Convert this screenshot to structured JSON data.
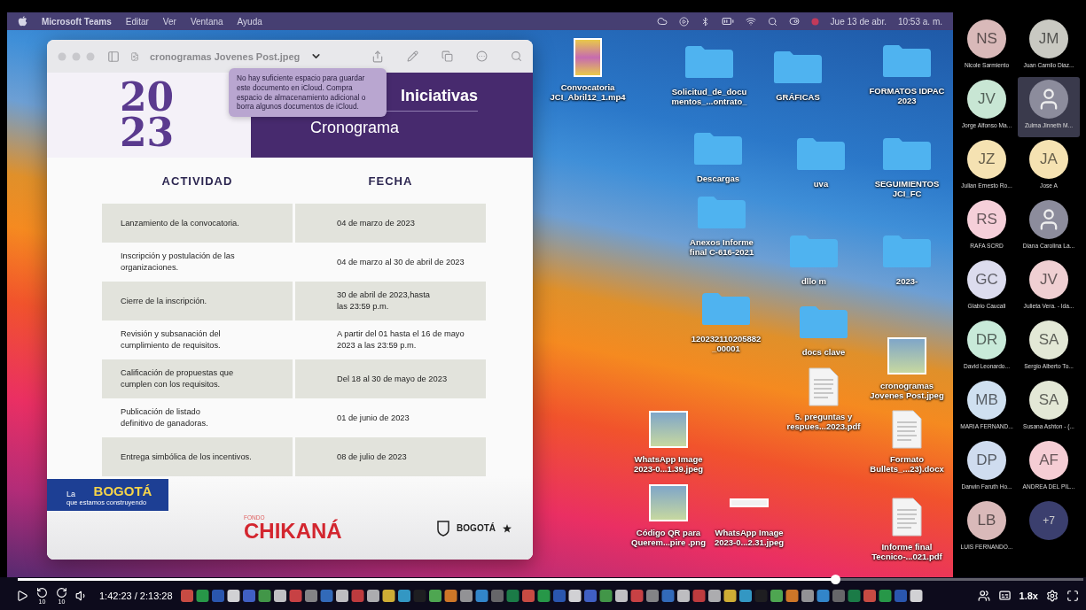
{
  "menu_bar": {
    "app": "Microsoft Teams",
    "menus": [
      "Editar",
      "Ver",
      "Ventana",
      "Ayuda"
    ],
    "date": "Jue 13 de abr.",
    "time": "10:53 a. m."
  },
  "preview_window": {
    "title": "cronogramas Jovenes Post.jpeg",
    "tooltip": "No hay suficiente espacio para guardar este documento en iCloud. Compra espacio de almacenamiento adicional o borra algunos documentos de iCloud.",
    "document": {
      "art_year": "2023",
      "heading": "Iniciativas",
      "subtitle": "Cronograma",
      "columns": [
        "ACTIVIDAD",
        "FECHA"
      ],
      "rows": [
        {
          "activity": "Lanzamiento de la convocatoria.",
          "date": "04 de marzo de 2023"
        },
        {
          "activity": "Inscripción y postulación de  las\norganizaciones.",
          "date": "04 de marzo al 30 de abril de 2023"
        },
        {
          "activity": "Cierre de la inscripción.",
          "date": "30 de abril de 2023,hasta\nlas 23:59 p.m."
        },
        {
          "activity": "Revisión y subsanación del\ncumplimiento  de requisitos.",
          "date": "A partir del 01 hasta el 16 de mayo\n2023 a las 23:59 p.m."
        },
        {
          "activity": "Calificación de propuestas que\ncumplen con  los requisitos.",
          "date": "Del 18 al 30 de mayo de 2023"
        },
        {
          "activity": "Publicación de listado\ndefinitivo de ganadoras.",
          "date": "01 de junio de 2023"
        },
        {
          "activity": "Entrega simbólica de los incentivos.",
          "date": "08 de julio de 2023"
        }
      ],
      "logo_left": {
        "prefix": "La",
        "name": "BOGOTÁ",
        "tagline": "que estamos construyendo"
      },
      "logo_center": {
        "small": "FONDO",
        "name": "CHIKANÁ"
      },
      "logo_right": "BOGOTÁ"
    }
  },
  "desktop_icons": [
    {
      "label": "Convocatoria\nJCI_Abril12_1.mp4",
      "kind": "video"
    },
    {
      "label": "Solicitud_de_docu\nmentos_...ontrato_",
      "kind": "folder"
    },
    {
      "label": "GRÁFICAS",
      "kind": "folder"
    },
    {
      "label": "FORMATOS IDPAC\n2023",
      "kind": "folder"
    },
    {
      "label": "Descargas",
      "kind": "folder"
    },
    {
      "label": "uva",
      "kind": "folder"
    },
    {
      "label": "SEGUIMIENTOS\nJCI_FC",
      "kind": "folder"
    },
    {
      "label": "Anexos Informe\nfinal C-616-2021",
      "kind": "folder"
    },
    {
      "label": "dllo m",
      "kind": "folder"
    },
    {
      "label": "2023-",
      "kind": "folder"
    },
    {
      "label": "120232110205882\n_00001",
      "kind": "folder"
    },
    {
      "label": "docs clave",
      "kind": "folder"
    },
    {
      "label": "cronogramas\nJovenes Post.jpeg",
      "kind": "image"
    },
    {
      "label": "5. preguntas y\nrespues...2023.pdf",
      "kind": "document"
    },
    {
      "label": "WhatsApp Image\n2023-0...1.39.jpeg",
      "kind": "image"
    },
    {
      "label": "Formato\nBullets_...23).docx",
      "kind": "document"
    },
    {
      "label": "Código QR para\nQuerem...pire .png",
      "kind": "image"
    },
    {
      "label": "WhatsApp Image\n2023-0...2.31.jpeg",
      "kind": "strip"
    },
    {
      "label": "Informe final\nTecnico-...021.pdf",
      "kind": "document"
    }
  ],
  "participants": [
    {
      "kind": "initials",
      "initials": "NS",
      "name": "Nicole Sarmiento",
      "color": "#d9b9b9",
      "highlighted": false
    },
    {
      "kind": "initials",
      "initials": "JM",
      "name": "Juan Camilo Diaz...",
      "color": "#c9c9c2",
      "highlighted": false
    },
    {
      "kind": "initials",
      "initials": "JV",
      "name": "Jorge Alfonso Ma...",
      "color": "#c8e6d4",
      "highlighted": false
    },
    {
      "kind": "photo",
      "name": "Zulma Jinneth M...",
      "highlighted": true
    },
    {
      "kind": "initials",
      "initials": "JZ",
      "name": "Julian Ernesto Ro...",
      "color": "#f5e2b2",
      "highlighted": false
    },
    {
      "kind": "initials",
      "initials": "JA",
      "name": "Jose A",
      "color": "#f5e2b2",
      "highlighted": false
    },
    {
      "kind": "initials",
      "initials": "RS",
      "name": "RAFA SCRD",
      "color": "#f5cfd9",
      "highlighted": false
    },
    {
      "kind": "photo",
      "name": "Diana Carolina La...",
      "highlighted": false
    },
    {
      "kind": "initials",
      "initials": "GC",
      "name": "Glabio Caucali",
      "color": "#dcdcee",
      "highlighted": false
    },
    {
      "kind": "initials",
      "initials": "JV",
      "name": "Julieta Vera. - Ida...",
      "color": "#efcfd2",
      "highlighted": false
    },
    {
      "kind": "initials",
      "initials": "DR",
      "name": "David Leonardo...",
      "color": "#c8ead9",
      "highlighted": false
    },
    {
      "kind": "initials",
      "initials": "SA",
      "name": "Sergio Alberto To...",
      "color": "#e3e8d6",
      "highlighted": false
    },
    {
      "kind": "initials",
      "initials": "MB",
      "name": "MARIA FERNAND...",
      "color": "#cfe0f0",
      "highlighted": false
    },
    {
      "kind": "initials",
      "initials": "SA",
      "name": "Susana Ashton - (...",
      "color": "#e3e8d6",
      "highlighted": false
    },
    {
      "kind": "initials",
      "initials": "DP",
      "name": "Darwin Faruth Ho...",
      "color": "#cfdcef",
      "highlighted": false
    },
    {
      "kind": "initials",
      "initials": "AF",
      "name": "ANDREA DEL PIL...",
      "color": "#f5cdd4",
      "highlighted": false
    },
    {
      "kind": "initials",
      "initials": "LB",
      "name": "LUIS FERNANDO...",
      "color": "#d9b9b9",
      "highlighted": false
    },
    {
      "kind": "overflow",
      "initials": "+7",
      "color": "#3b3f6e",
      "highlighted": false
    }
  ],
  "player": {
    "level": 0.767,
    "skip_back": "10",
    "skip_forward": "10",
    "time": "1:42:23 / 2:13:28",
    "speed": "1.8x"
  }
}
